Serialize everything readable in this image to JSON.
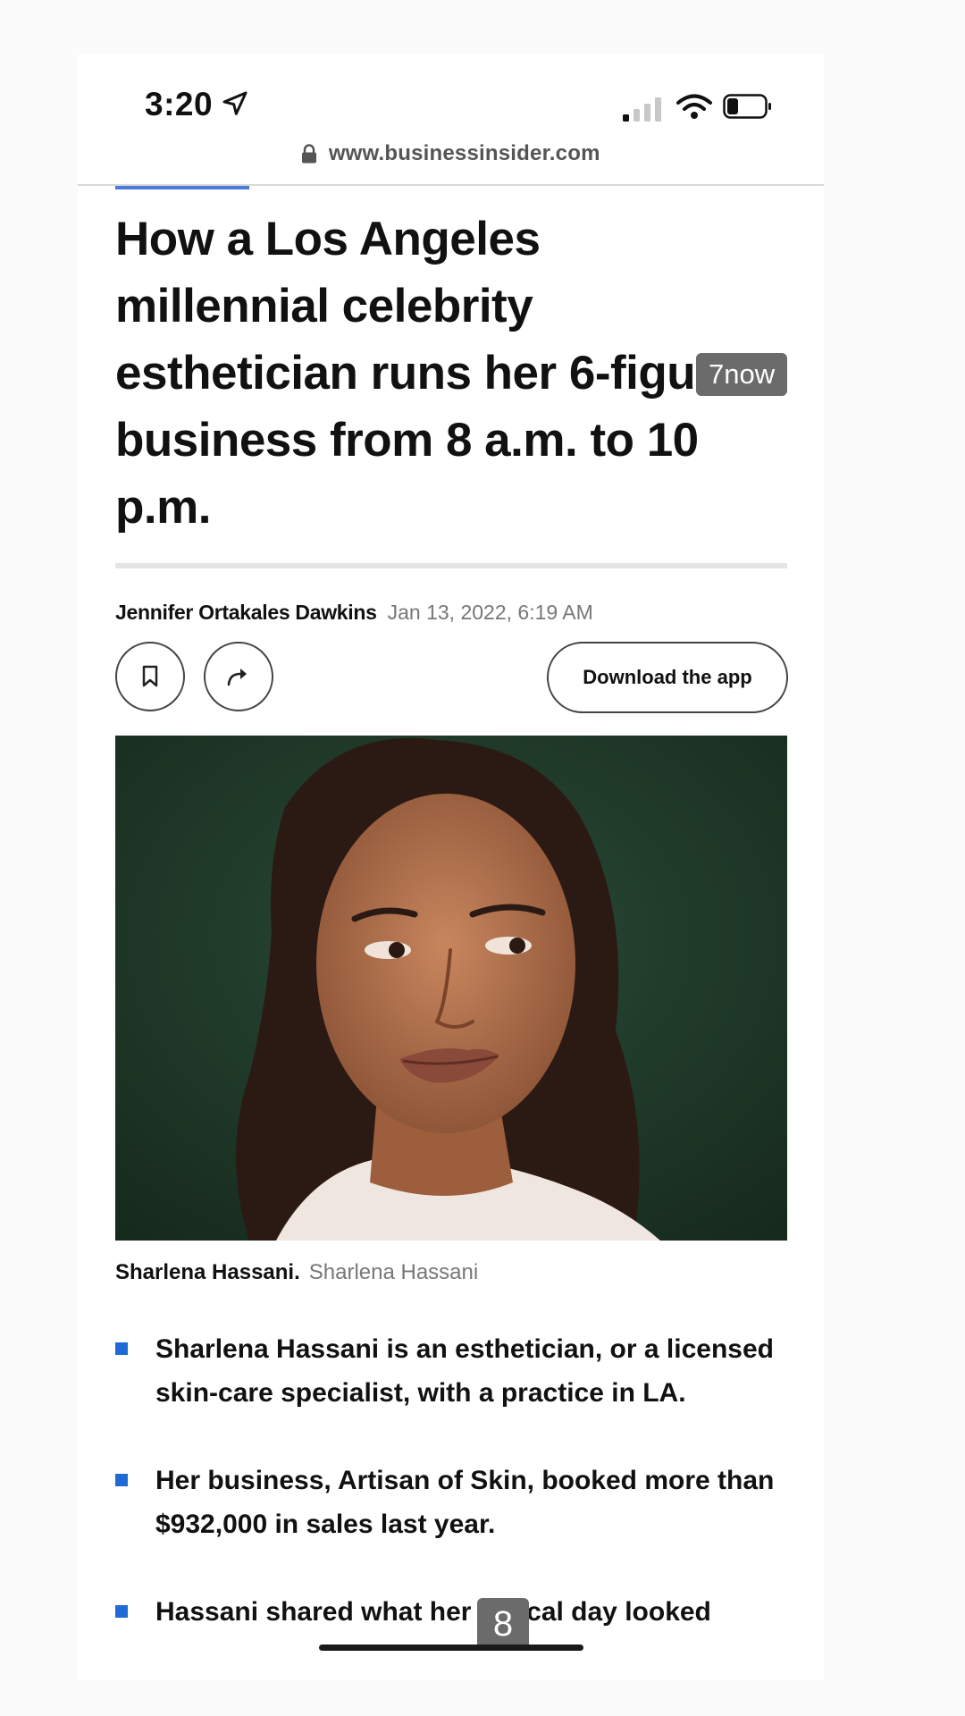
{
  "status_bar": {
    "time": "3:20",
    "icons": [
      "location-arrow-icon",
      "signal-icon",
      "wifi-icon",
      "battery-icon"
    ]
  },
  "browser": {
    "url": "www.businessinsider.com",
    "lock_icon": "lock-icon"
  },
  "article": {
    "headline": "How a Los Angeles millennial celebrity esthetician runs her 6-figure business from 8 a.m. to 10 p.m.",
    "author": "Jennifer Ortakales Dawkins",
    "date": "Jan 13, 2022, 6:19 AM",
    "actions": {
      "bookmark_icon": "bookmark-icon",
      "share_icon": "share-icon",
      "download_label": "Download the app"
    },
    "image_caption": {
      "name": "Sharlena Hassani.",
      "credit": "Sharlena Hassani"
    },
    "bullets": [
      "Sharlena Hassani is an esthetician, or a licensed skin-care specialist, with a practice in LA.",
      "Her business, Artisan of Skin, booked more than $932,000 in sales last year.",
      "Hassani shared what her typical day looked"
    ]
  },
  "overlays": {
    "toast": "7now",
    "page_number": "8"
  },
  "colors": {
    "accent_blue": "#1e6bd6",
    "photo_background": "#1f3a2a"
  }
}
